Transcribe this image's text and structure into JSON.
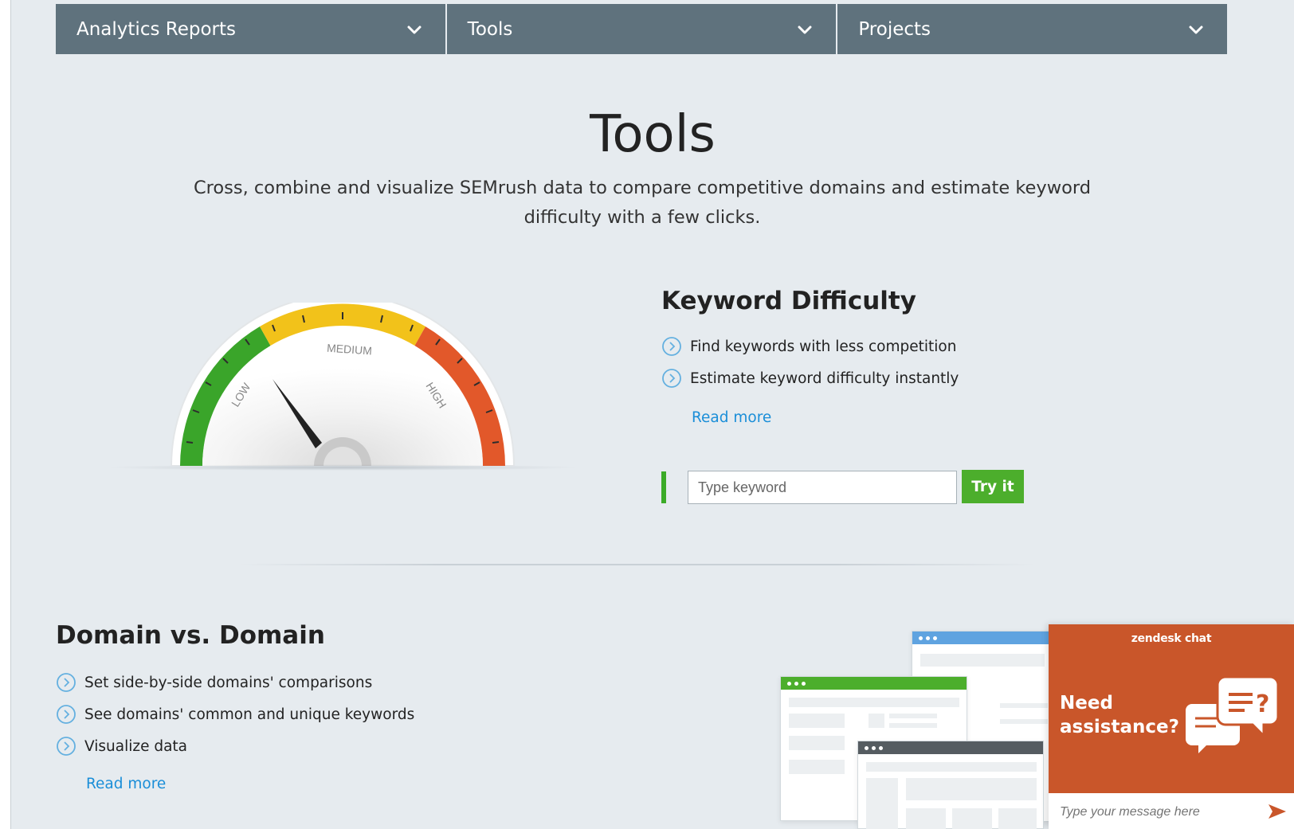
{
  "nav": {
    "items": [
      {
        "label": "Analytics Reports"
      },
      {
        "label": "Tools"
      },
      {
        "label": "Projects"
      }
    ]
  },
  "hero": {
    "title": "Tools",
    "subtitle": "Cross, combine and visualize SEMrush data to compare competitive domains and estimate keyword difficulty with a few clicks."
  },
  "keyword_difficulty": {
    "title": "Keyword Difficulty",
    "bullets": [
      "Find keywords with less competition",
      "Estimate keyword difficulty instantly"
    ],
    "read_more": "Read more",
    "input_placeholder": "Type keyword",
    "button_label": "Try it",
    "gauge": {
      "labels": {
        "low": "LOW",
        "medium": "MEDIUM",
        "high": "HIGH"
      },
      "colors": {
        "low": "#3aa52a",
        "medium": "#f2c21a",
        "high": "#e2582a"
      }
    }
  },
  "domain_vs_domain": {
    "title": "Domain vs. Domain",
    "bullets": [
      "Set side-by-side domains' comparisons",
      "See domains' common and unique keywords",
      "Visualize data"
    ],
    "read_more": "Read more"
  },
  "chat": {
    "brand": "zendesk chat",
    "prompt_line1": "Need",
    "prompt_line2": "assistance?",
    "input_placeholder": "Type your message here",
    "accent": "#c9562a"
  },
  "colors": {
    "nav_bg": "#5f727d",
    "page_bg": "#e6ebef",
    "link": "#1a8ed8",
    "cta": "#4cae2c"
  }
}
